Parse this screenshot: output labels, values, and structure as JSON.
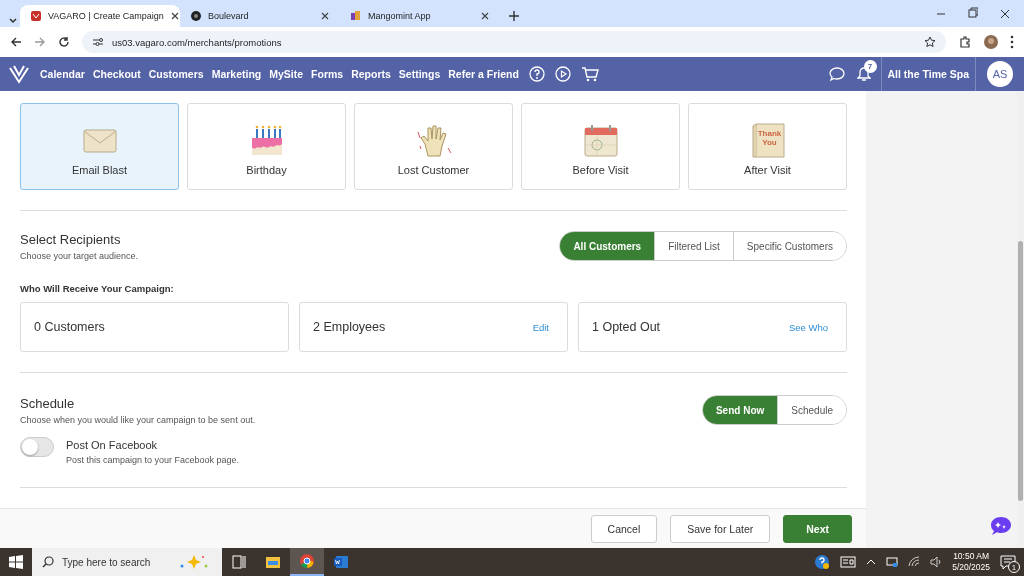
{
  "browser": {
    "tabs": [
      {
        "title": "VAGARO | Create Campaign",
        "selected": true
      },
      {
        "title": "Boulevard",
        "selected": false
      },
      {
        "title": "Mangomint App",
        "selected": false
      }
    ],
    "url": "us03.vagaro.com/merchants/promotions"
  },
  "nav": {
    "items": [
      "Calendar",
      "Checkout",
      "Customers",
      "Marketing",
      "MySite",
      "Forms",
      "Reports",
      "Settings",
      "Refer a Friend"
    ],
    "notification_count": "7",
    "business": "All the Time Spa",
    "avatar": "AS"
  },
  "campaign_types": [
    {
      "label": "Email Blast",
      "kind": "envelope",
      "selected": true
    },
    {
      "label": "Birthday",
      "kind": "cake",
      "selected": false
    },
    {
      "label": "Lost Customer",
      "kind": "glove",
      "selected": false
    },
    {
      "label": "Before Visit",
      "kind": "calendar",
      "selected": false
    },
    {
      "label": "After Visit",
      "kind": "card",
      "selected": false,
      "icon_text": "Thank You"
    }
  ],
  "recipients": {
    "title": "Select Recipients",
    "subtitle": "Choose your target audience.",
    "options": [
      {
        "label": "All Customers",
        "selected": true
      },
      {
        "label": "Filtered List",
        "selected": false
      },
      {
        "label": "Specific Customers",
        "selected": false
      }
    ],
    "receive_label": "Who Will Receive Your Campaign:",
    "counts": [
      {
        "label": "0 Customers"
      },
      {
        "label": "2 Employees",
        "action": "Edit"
      },
      {
        "label": "1 Opted Out",
        "action": "See Who"
      }
    ]
  },
  "schedule": {
    "title": "Schedule",
    "subtitle": "Choose when you would like your campaign to be sent out.",
    "options": [
      {
        "label": "Send Now",
        "selected": true
      },
      {
        "label": "Schedule",
        "selected": false
      }
    ],
    "facebook": {
      "label": "Post On Facebook",
      "description": "Post this campaign to your Facebook page.",
      "on": false
    }
  },
  "footer": {
    "buttons": [
      {
        "label": "Cancel",
        "kind": "secondary"
      },
      {
        "label": "Save for Later",
        "kind": "secondary"
      },
      {
        "label": "Next",
        "kind": "primary"
      }
    ]
  },
  "taskbar": {
    "search_placeholder": "Type here to search",
    "time": "10:50 AM",
    "date": "5/20/2025",
    "notification_count": "1"
  }
}
